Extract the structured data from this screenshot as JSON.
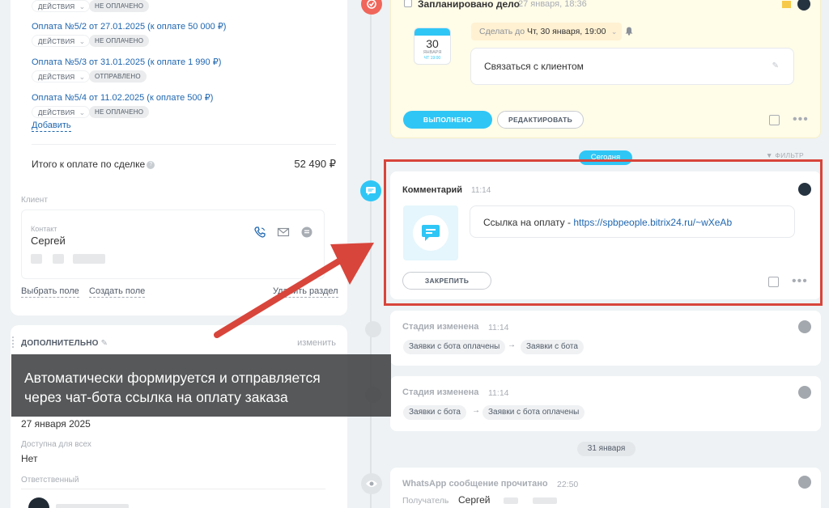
{
  "payments": [
    {
      "action_label": "действия",
      "status": "не оплачено"
    },
    {
      "title": "Оплата №5/2 от 27.01.2025 (к оплате 50 000 ₽)",
      "action_label": "действия",
      "status": "не оплачено"
    },
    {
      "title": "Оплата №5/3 от 31.01.2025 (к оплате 1 990 ₽)",
      "action_label": "действия",
      "status": "отправлено"
    },
    {
      "title": "Оплата №5/4 от 11.02.2025 (к оплате 500 ₽)",
      "action_label": "действия",
      "status": "не оплачено"
    }
  ],
  "add_label": "Добавить",
  "total": {
    "label": "Итого к оплате по сделке",
    "value": "52 490 ₽"
  },
  "client": {
    "section_label": "Клиент",
    "contact_label": "Контакт",
    "contact_name": "Сергей"
  },
  "field_links": {
    "select": "Выбрать поле",
    "create": "Создать поле",
    "delete": "Удалить раздел"
  },
  "extra": {
    "title": "ДОПОЛНИТЕЛЬНО",
    "edit_label": "изменить",
    "date_value": "27 января 2025",
    "available_label": "Доступна для всех",
    "available_value": "Нет",
    "responsible_label": "Ответственный"
  },
  "caption": {
    "line1": "Автоматически формируется и отправляется",
    "line2": "через чат-бота ссылка на оплату заказа"
  },
  "activity": {
    "title": "Запланировано дело",
    "date": "27 января, 18:36",
    "calendar": {
      "day": "30",
      "month": "ЯНВАРЯ",
      "time": "ЧТ 19:00"
    },
    "deadline_prefix": "Сделать до",
    "deadline_value": "Чт, 30 января, 19:00",
    "text": "Связаться с клиентом",
    "done_label": "выполнено",
    "edit_label": "редактировать"
  },
  "today_label": "Сегодня",
  "filter_label": "ФИЛЬТР",
  "comment": {
    "title": "Комментарий",
    "time": "11:14",
    "text_prefix": "Ссылка на оплату - ",
    "link": "https://spbpeople.bitrix24.ru/~wXeAb",
    "pin_label": "закрепить"
  },
  "stage_changes": [
    {
      "title": "Стадия изменена",
      "time": "11:14",
      "from": "Заявки с бота оплачены",
      "to": "Заявки с бота"
    },
    {
      "title": "Стадия изменена",
      "time": "11:14",
      "from": "Заявки с бота",
      "to": "Заявки с бота оплачены"
    }
  ],
  "date_divider": "31 января",
  "whatsapp": {
    "title": "WhatsApp сообщение прочитано",
    "time": "22:50",
    "recipient_label": "Получатель",
    "recipient_name": "Сергей"
  },
  "colors": {
    "accent": "#2fc6f6",
    "link": "#2067b0",
    "highlight": "#d8453b"
  }
}
